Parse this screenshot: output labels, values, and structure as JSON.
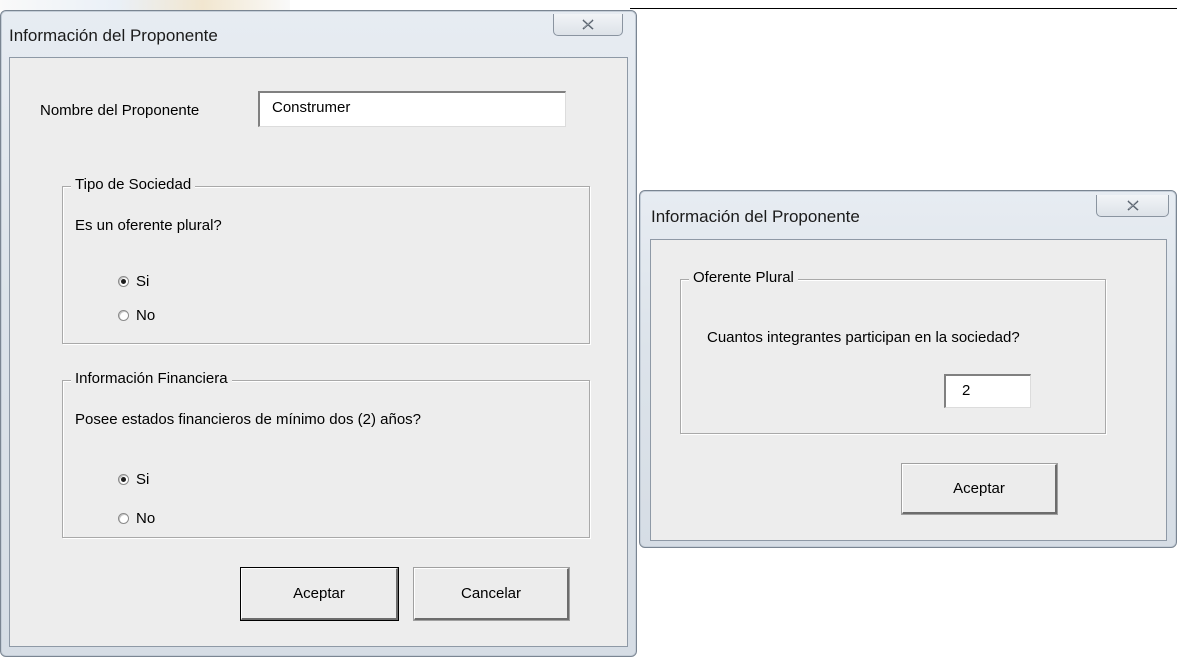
{
  "left_dialog": {
    "title": "Información del Proponente",
    "close_icon": "x-close-icon",
    "name_label": "Nombre del Proponente",
    "name_value": "Construmer",
    "company_type_group": {
      "legend": "Tipo de Sociedad",
      "question": "Es un oferente plural?",
      "options": [
        {
          "label": "Si",
          "checked": true
        },
        {
          "label": "No",
          "checked": false
        }
      ]
    },
    "financial_group": {
      "legend": "Información Financiera",
      "question": "Posee estados financieros de mínimo dos (2) años?",
      "options": [
        {
          "label": "Si",
          "checked": true
        },
        {
          "label": "No",
          "checked": false
        }
      ]
    },
    "accept_label": "Aceptar",
    "cancel_label": "Cancelar"
  },
  "right_dialog": {
    "title": "Información del Proponente",
    "close_icon": "x-close-icon",
    "group": {
      "legend": "Oferente Plural",
      "question": "Cuantos integrantes participan en la sociedad?",
      "count_value": "2"
    },
    "accept_label": "Aceptar"
  }
}
